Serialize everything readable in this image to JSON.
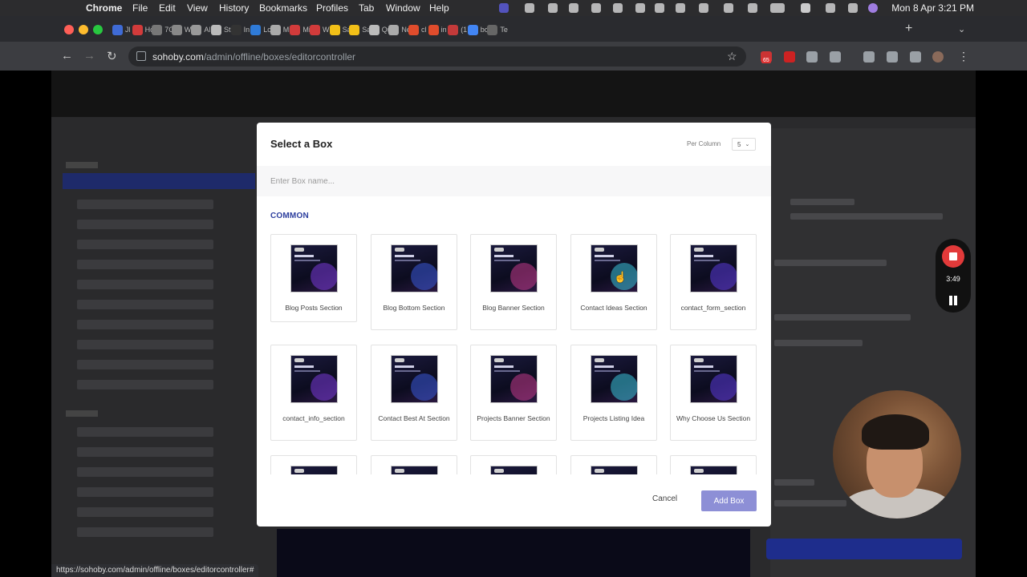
{
  "menubar": {
    "app": "Chrome",
    "items": [
      "File",
      "Edit",
      "View",
      "History",
      "Bookmarks",
      "Profiles",
      "Tab",
      "Window",
      "Help"
    ],
    "clock": "Mon 8 Apr  3:21 PM"
  },
  "browser": {
    "tabs": [
      {
        "label": "Jl",
        "color": "#3f6bd6"
      },
      {
        "label": "Hc",
        "color": "#d23b3b"
      },
      {
        "label": "7C",
        "color": "#777777"
      },
      {
        "label": "W",
        "color": "#888888"
      },
      {
        "label": "Al",
        "color": "#999999"
      },
      {
        "label": "St",
        "color": "#bbbbbb"
      },
      {
        "label": "In",
        "color": "#333333"
      },
      {
        "label": "Lc",
        "color": "#2f7bd8"
      },
      {
        "label": "Mi",
        "color": "#aaaaaa"
      },
      {
        "label": "Mi",
        "color": "#d23b3b"
      },
      {
        "label": "W",
        "color": "#d23b3b"
      },
      {
        "label": "Sa",
        "color": "#f2c018"
      },
      {
        "label": "Sa",
        "color": "#f2c018"
      },
      {
        "label": "Qu",
        "color": "#bbbbbb"
      },
      {
        "label": "Ne",
        "color": "#aaaaaa"
      },
      {
        "label": "cl",
        "color": "#e04c2c"
      },
      {
        "label": "in",
        "color": "#e04c2c"
      },
      {
        "label": "(1",
        "color": "#c33a3a"
      },
      {
        "label": "bc",
        "color": "#4285f4"
      },
      {
        "label": "Te",
        "color": "#666666"
      }
    ],
    "url_domain": "sohoby.com",
    "url_path": "/admin/offline/boxes/editorcontroller",
    "extension_badge": "65",
    "status_url": "https://sohoby.com/admin/offline/boxes/editorcontroller#"
  },
  "modal": {
    "title": "Select a Box",
    "per_column_label": "Per Column",
    "per_column_value": "5",
    "search_placeholder": "Enter Box name...",
    "section": "COMMON",
    "boxes": [
      {
        "label": "Blog Posts Section"
      },
      {
        "label": "Blog Bottom Section"
      },
      {
        "label": "Blog Banner Section"
      },
      {
        "label": "Contact Ideas Section"
      },
      {
        "label": "contact_form_section"
      },
      {
        "label": "contact_info_section"
      },
      {
        "label": "Contact Best At Section"
      },
      {
        "label": "Projects Banner Section"
      },
      {
        "label": "Projects Listing Idea"
      },
      {
        "label": "Why Choose Us Section"
      },
      {
        "label": ""
      },
      {
        "label": ""
      },
      {
        "label": ""
      },
      {
        "label": ""
      },
      {
        "label": ""
      }
    ],
    "cancel_label": "Cancel",
    "add_label": "Add Box"
  },
  "recorder": {
    "time": "3:49"
  }
}
